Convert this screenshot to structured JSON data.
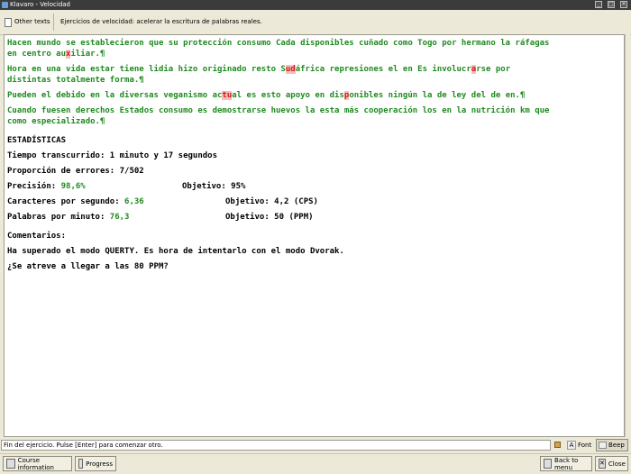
{
  "window": {
    "title": "Klavaro - Velocidad",
    "controls": [
      "_",
      "□",
      "✕"
    ]
  },
  "toolbar": {
    "other_texts_label": "Other texts",
    "exercise_title": "Ejercicios de velocidad: acelerar la escritura de palabras reales."
  },
  "text": {
    "p1_l1": "Hacen mundo se establecieron que su protección consumo Cada disponibles cuñado como Togo por hermano la ráfagas",
    "p1_l2a": "en centro au",
    "p1_l2err": "x",
    "p1_l2b": "iliar.¶",
    "p2_l1a": "Hora en una vida estar tiene lidia hizo originado resto S",
    "p2_l1err1": "ud",
    "p2_l1b": "áfrica represiones el en Es involucr",
    "p2_l1err2": "a",
    "p2_l1c": "rse por",
    "p2_l2": "distintas totalmente forma.¶",
    "p3_a": "Pueden el debido en la diversas veganismo ac",
    "p3_err1": "tu",
    "p3_b": "al es esto apoyo en dis",
    "p3_err2": "p",
    "p3_c": "onibles ningún la de ley del de en.¶",
    "p4_l1": "Cuando fuesen derechos Estados consumo es demostrarse huevos la esta más cooperación los en la nutrición km que",
    "p4_l2": "como especializado.¶"
  },
  "stats": {
    "heading": "ESTADÍSTICAS",
    "time": "Tiempo transcurrido: 1 minuto y 17 segundos",
    "error_ratio": "Proporción de errores: 7/502",
    "accuracy_label": "Precisión:",
    "accuracy_value": "98,6%",
    "accuracy_target": "Objetivo: 95%",
    "cps_label": "Caracteres por segundo:",
    "cps_value": "6,36",
    "cps_target": "Objetivo: 4,2 (CPS)",
    "wpm_label": "Palabras por minuto:",
    "wpm_value": "76,3",
    "wpm_target": "Objetivo: 50 (PPM)"
  },
  "comments": {
    "heading": "Comentarios:",
    "line1": "Ha superado el modo QUERTY. Es hora de intentarlo con el modo Dvorak.",
    "line2": "¿Se atreve a llegar a las 80 PPM?"
  },
  "status": {
    "message": "Fin del ejercicio. Pulse [Enter] para comenzar otro."
  },
  "controls": {
    "font_label": "Font",
    "beep_label": "Beep",
    "course_info_label": "Course information",
    "progress_label": "Progress",
    "back_label": "Back to menu",
    "close_label": "Close"
  },
  "colors": {
    "typed_text": "#1f8a1f",
    "error_highlight": "#f7bcbc",
    "error_text": "#d61a1a"
  }
}
